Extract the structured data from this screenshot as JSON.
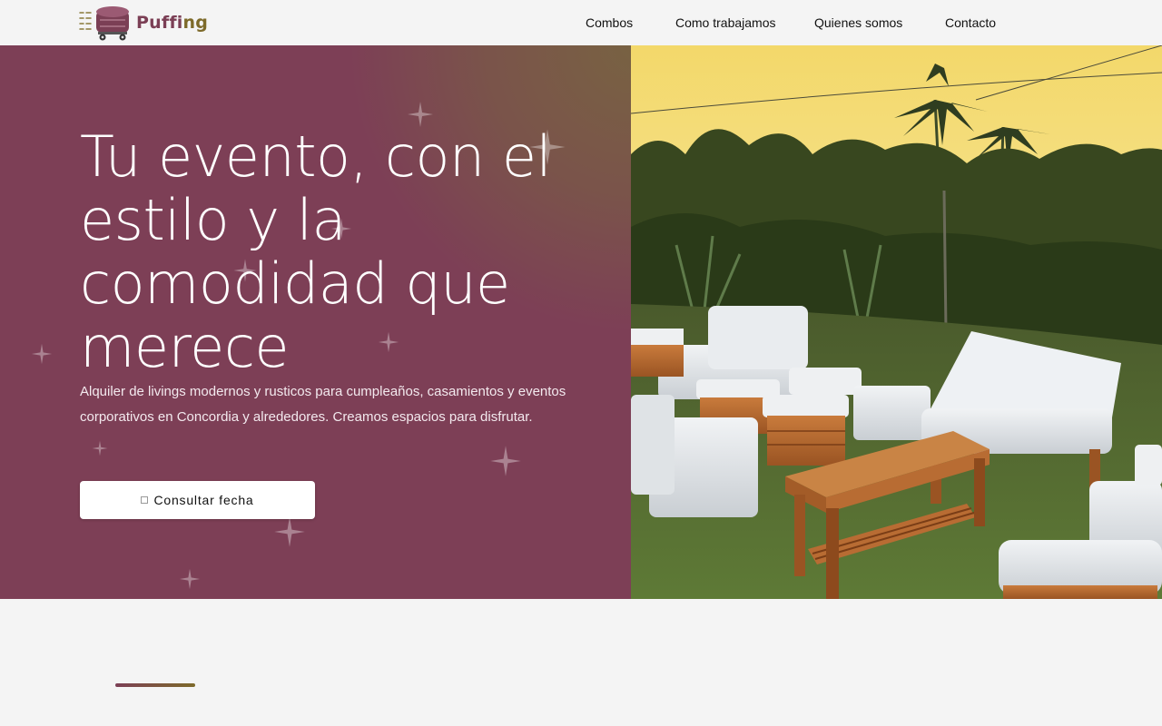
{
  "brand": {
    "name_part1": "Puffi",
    "name_part2": "ng",
    "color_primary": "#7b3f55",
    "color_accent": "#7d6a2a",
    "logo_icon": "puff-cart-icon"
  },
  "nav": {
    "items": [
      {
        "label": "Combos"
      },
      {
        "label": "Como trabajamos"
      },
      {
        "label": "Quienes somos"
      },
      {
        "label": "Contacto"
      }
    ]
  },
  "hero": {
    "title": "Tu evento, con el estilo y la comodidad que merece",
    "subtitle": "Alquiler de livings modernos y rusticos para cumpleaños, casamientos y eventos corporativos en Concordia y alrededores. Creamos espacios para disfrutar.",
    "cta_label": "Consultar fecha",
    "cta_icon": "calendar-icon",
    "background_color": "#7d3f56",
    "photo_description_icon": "outdoor-lounge-photo"
  }
}
